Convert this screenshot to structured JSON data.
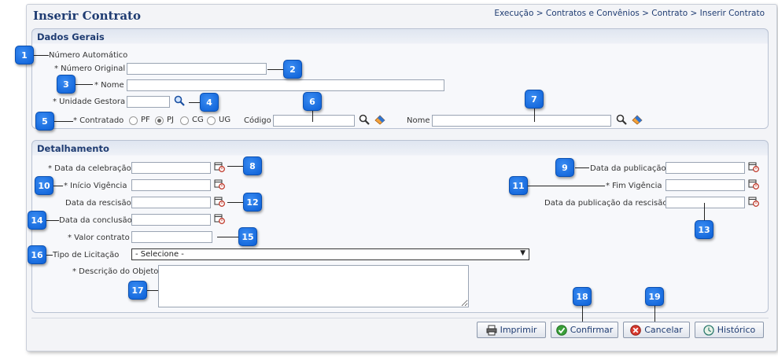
{
  "page": {
    "title": "Inserir Contrato",
    "breadcrumb": "Execução > Contratos e Convênios > Contrato > Inserir Contrato"
  },
  "dados_gerais": {
    "title": "Dados Gerais",
    "numero_automatico": "Número Automático",
    "numero_original": "* Número Original",
    "nome": "* Nome",
    "unidade_gestora": "* Unidade Gestora",
    "contratado": "* Contratado",
    "radio_pf": "PF",
    "radio_pj": "PJ",
    "radio_cg": "CG",
    "radio_ug": "UG",
    "codigo": "Código",
    "nome2": "Nome"
  },
  "detalhamento": {
    "title": "Detalhamento",
    "data_celebracao": "* Data da celebração",
    "inicio_vigencia": "* Início Vigência",
    "data_rescisao": "Data da rescisão",
    "data_conclusao": "Data da conclusão",
    "valor_contrato": "* Valor contrato",
    "tipo_licitacao": "Tipo de Licitação",
    "tipo_licitacao_value": "- Selecione -",
    "descricao_objeto": "* Descrição do Objeto",
    "data_publicacao": "Data da publicação",
    "fim_vigencia": "* Fim Vigência",
    "data_publicacao_rescisao": "Data da publicação da rescisão"
  },
  "buttons": {
    "imprimir": "Imprimir",
    "confirmar": "Confirmar",
    "cancelar": "Cancelar",
    "historico": "Histórico"
  },
  "markers": [
    "1",
    "2",
    "3",
    "4",
    "5",
    "6",
    "7",
    "8",
    "9",
    "10",
    "11",
    "12",
    "13",
    "14",
    "15",
    "16",
    "17",
    "18",
    "19"
  ],
  "colors": {
    "marker": "#0b5fd6",
    "title": "#1f3c72",
    "cancel": "#d83a2e",
    "confirm": "#3aa03a"
  }
}
